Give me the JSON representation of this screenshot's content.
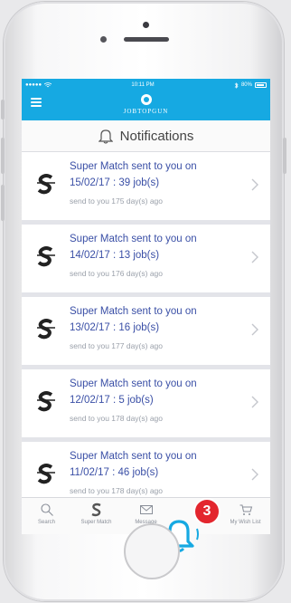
{
  "status_bar": {
    "signal": "●●●●●",
    "time": "10:11 PM",
    "battery": "80%"
  },
  "nav": {
    "logo_text": "JOBTOPGUN"
  },
  "header": {
    "title": "Notifications"
  },
  "notifications": [
    {
      "title": "Super Match sent to you on",
      "detail": "15/02/17 : 39 job(s)",
      "age": "send to you 175 day(s) ago"
    },
    {
      "title": "Super Match sent to you on",
      "detail": "14/02/17 : 13 job(s)",
      "age": "send to you 176 day(s) ago"
    },
    {
      "title": "Super Match sent to you on",
      "detail": "13/02/17 : 16 job(s)",
      "age": "send to you 177 day(s) ago"
    },
    {
      "title": "Super Match sent to you on",
      "detail": "12/02/17 : 5 job(s)",
      "age": "send to you 178 day(s) ago"
    },
    {
      "title": "Super Match sent to you on",
      "detail": "11/02/17 : 46 job(s)",
      "age": "send to you 178 day(s) ago"
    }
  ],
  "tabs": [
    {
      "label": "Search",
      "icon": "search-icon"
    },
    {
      "label": "Super Match",
      "icon": "super-match-icon"
    },
    {
      "label": "Message",
      "icon": "envelope-icon"
    },
    {
      "label": "",
      "icon": "bell-icon"
    },
    {
      "label": "My Wish List",
      "icon": "cart-icon"
    }
  ],
  "badge": {
    "count": "3"
  },
  "colors": {
    "brand": "#16a9e2",
    "link": "#3a4fa6",
    "badge": "#e3262e"
  }
}
